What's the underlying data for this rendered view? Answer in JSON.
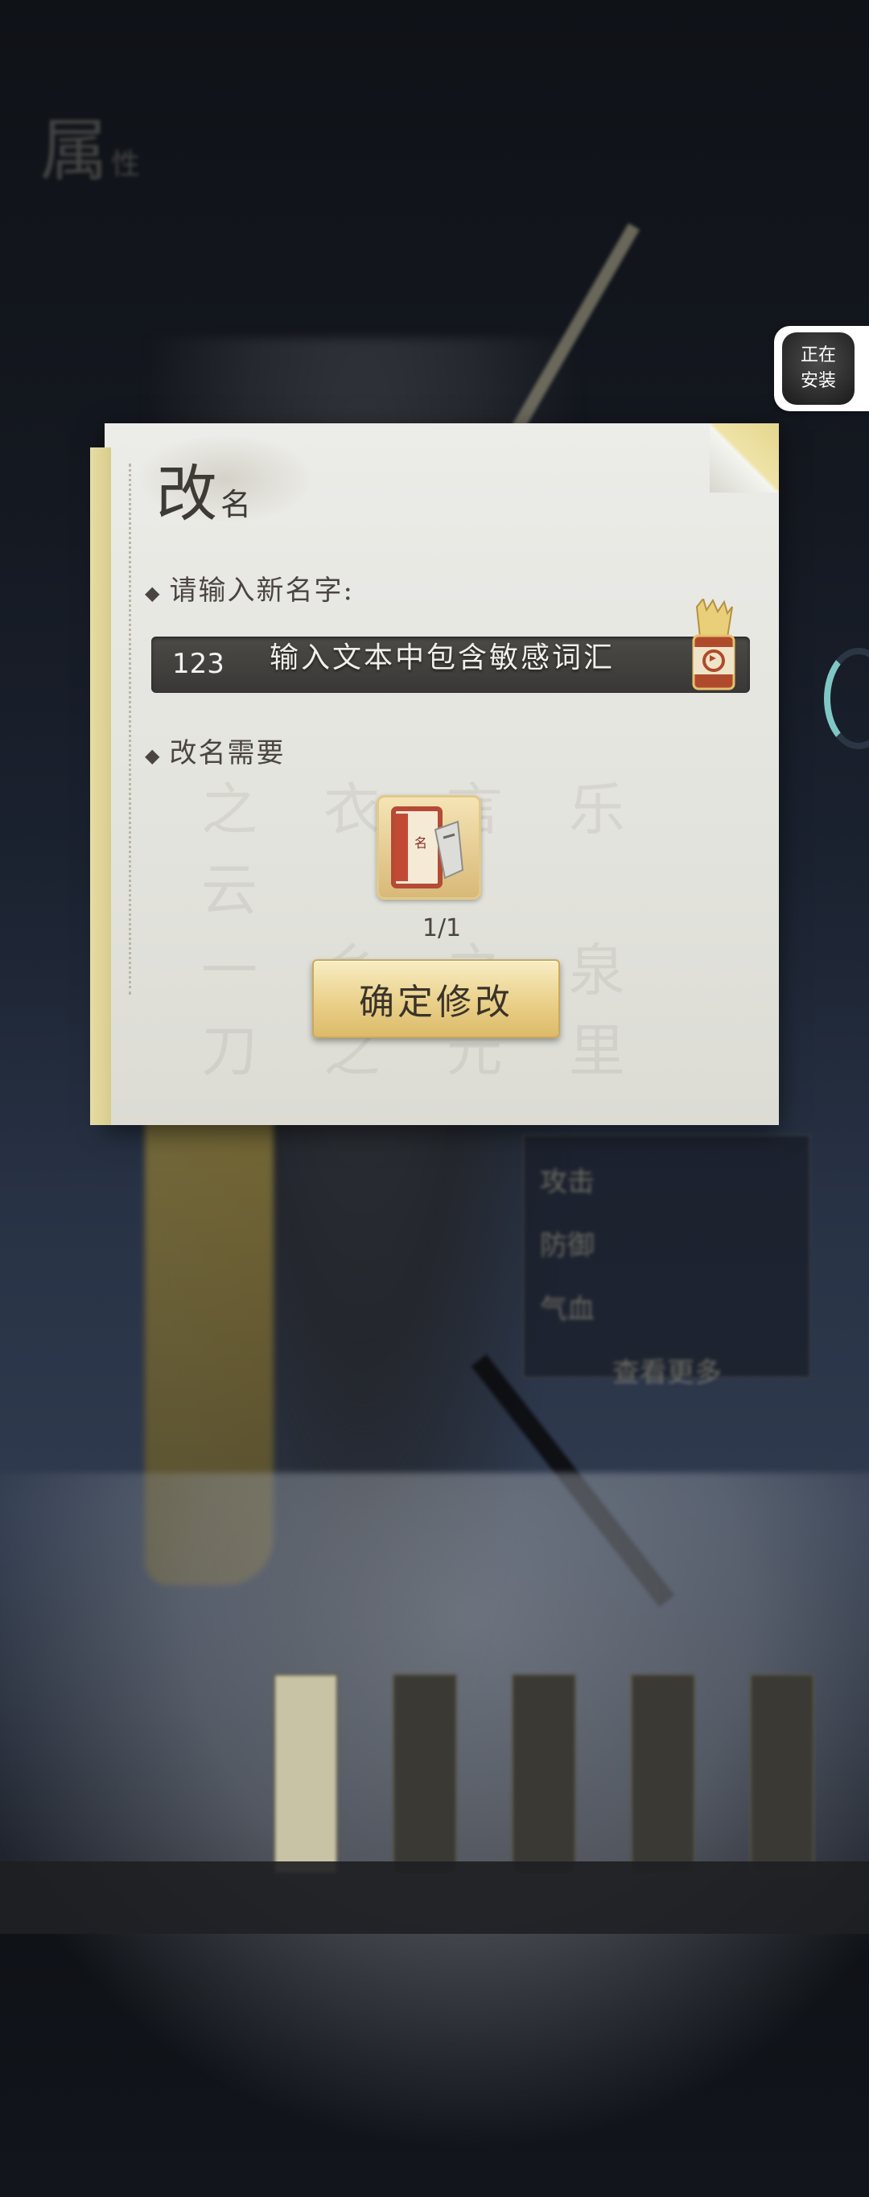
{
  "background": {
    "title": "属",
    "title_small": "性",
    "stats": [
      "攻击",
      "防御",
      "气血"
    ],
    "more_button": "查看更多"
  },
  "install_pill": {
    "line1": "正在",
    "line2": "安装",
    "icon": "app-install-icon"
  },
  "modal": {
    "title_big": "改",
    "title_small": "名",
    "input_label": "请输入新名字:",
    "name_value": "123",
    "toast": "输入文本中包含敏感词汇",
    "random_icon": "random-name-dice-icon",
    "requirement_label": "改名需要",
    "item_icon": "rename-card-item-icon",
    "item_count": "1/1",
    "confirm_label": "确定修改"
  },
  "colors": {
    "panel": "#e6e6e1",
    "spine": "#e0d498",
    "input_bar": "#413f3d",
    "button_gold": "#ead08a",
    "text_dark": "#3e3a36"
  }
}
